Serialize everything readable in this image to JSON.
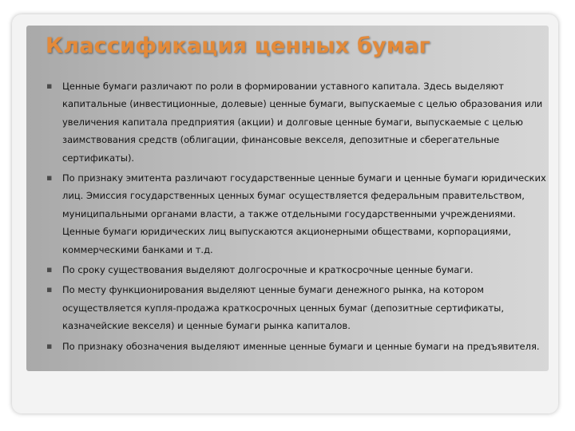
{
  "slide": {
    "title": "Классификация ценных бумаг",
    "colors": {
      "title": "#e38a3a",
      "text": "#111111",
      "panel": "#c0c0c0",
      "frame": "#f3f3f3"
    },
    "bullet_icon": "bullet-icon",
    "bullets": [
      {
        "text": "Ценные бумаги различают по роли в формировании уставного капитала. Здесь выделяют капитальные (инвестиционные, долевые) ценные бумаги, выпускаемые с целью образования или увеличения капитала предприятия (акции) и долговые ценные бумаги, выпускаемые с целью заимствования средств (облигации, финансовые векселя, депозитные и сберегательные сертификаты)."
      },
      {
        "text": "По признаку эмитента различают государственные ценные бумаги и ценные бумаги юридических лиц. Эмиссия государственных ценных бумаг осуществляется федеральным правительством, муниципальными органами власти, а также отдельными государственными учреждениями. Ценные бумаги юридических лиц выпускаются акционерными обществами, корпорациями, коммерческими банками и т.д."
      },
      {
        "text": "По сроку существования выделяют долгосрочные и краткосрочные ценные бумаги."
      },
      {
        "text": "По месту функционирования выделяют ценные бумаги денежного рынка, на котором осуществляется купля-продажа краткосрочных ценных бумаг (депозитные сертификаты, казначейские векселя) и ценные бумаги рынка капиталов."
      },
      {
        "text": "По признаку обозначения выделяют именные ценные бумаги и ценные бумаги на предъявителя."
      }
    ]
  }
}
